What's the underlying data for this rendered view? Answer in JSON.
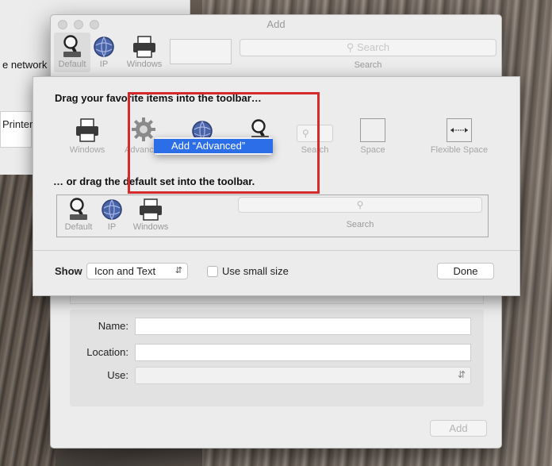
{
  "background_window": {
    "network_label": "e network",
    "printer_label": "Printer"
  },
  "add_window": {
    "title": "Add",
    "toolbar": {
      "items": [
        {
          "label": "Default",
          "icon": "magnifier-icon"
        },
        {
          "label": "IP",
          "icon": "globe-icon"
        },
        {
          "label": "Windows",
          "icon": "printer-icon"
        }
      ],
      "search_placeholder": "Search",
      "search_label": "Search"
    },
    "form": {
      "name_label": "Name:",
      "location_label": "Location:",
      "use_label": "Use:",
      "name_value": "",
      "location_value": "",
      "use_value": ""
    },
    "add_button": "Add"
  },
  "customize_sheet": {
    "heading": "Drag your favorite items into the toolbar…",
    "palette": [
      {
        "label": "Windows",
        "icon": "printer-icon"
      },
      {
        "label": "Advanced",
        "icon": "gear-icon"
      },
      {
        "label": "",
        "icon": "globe-icon"
      },
      {
        "label": "",
        "icon": "magnifier-icon"
      },
      {
        "label": "Search",
        "icon": "search-icon"
      },
      {
        "label": "Space",
        "icon": "space-icon"
      },
      {
        "label": "Flexible Space",
        "icon": "flexible-space-icon"
      }
    ],
    "default_heading": "… or drag the default set into the toolbar.",
    "default_set": [
      {
        "label": "Default",
        "icon": "magnifier-icon"
      },
      {
        "label": "IP",
        "icon": "globe-icon"
      },
      {
        "label": "Windows",
        "icon": "printer-icon"
      }
    ],
    "default_search_label": "Search",
    "show_label": "Show",
    "show_value": "Icon and Text",
    "small_size_label": "Use small size",
    "small_size_checked": false,
    "done_button": "Done"
  },
  "context_menu": {
    "item": "Add “Advanced”"
  },
  "colors": {
    "highlight": "#2b6ee8",
    "annotation_box": "#d62a2a"
  }
}
